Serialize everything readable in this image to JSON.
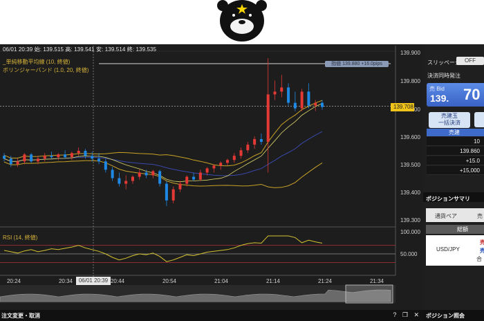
{
  "chart": {
    "info_line": "06/01 20:39 始: 139.515 高: 139.541 安: 139.514 終: 139.535",
    "legend_sma": "_単純移動平均線 (10, 終値)",
    "legend_bb": "ボリンジャーバンド (1.0, 20, 終値)",
    "legend_rsi": "RSI (14, 終値)",
    "price_axis": [
      "139.900",
      "139.800",
      "139.700",
      "139.600",
      "139.500",
      "139.400",
      "139.300"
    ],
    "rsi_axis": [
      "100.000",
      "50.000"
    ],
    "time_axis": [
      "20:24",
      "20:34",
      "20:44",
      "20:54",
      "21:04",
      "21:14",
      "21:24",
      "21:34"
    ],
    "cursor_time": "06/01 20:39",
    "current_price_tag": "139.708",
    "hline_tag": "指値 139.880 +16.0pips",
    "colors": {
      "up": "#e53935",
      "down": "#1e88e5",
      "band": "#c9a227",
      "sma": "#3949ab",
      "rsi": "#d6c22f"
    },
    "candles": [
      {
        "o": 139.53,
        "h": 139.54,
        "l": 139.51,
        "c": 139.52
      },
      {
        "o": 139.52,
        "h": 139.53,
        "l": 139.49,
        "c": 139.5
      },
      {
        "o": 139.5,
        "h": 139.52,
        "l": 139.49,
        "c": 139.51
      },
      {
        "o": 139.51,
        "h": 139.54,
        "l": 139.5,
        "c": 139.535
      },
      {
        "o": 139.535,
        "h": 139.54,
        "l": 139.505,
        "c": 139.51
      },
      {
        "o": 139.51,
        "h": 139.53,
        "l": 139.5,
        "c": 139.52
      },
      {
        "o": 139.52,
        "h": 139.54,
        "l": 139.51,
        "c": 139.53
      },
      {
        "o": 139.53,
        "h": 139.545,
        "l": 139.52,
        "c": 139.525
      },
      {
        "o": 139.525,
        "h": 139.54,
        "l": 139.515,
        "c": 139.535
      },
      {
        "o": 139.535,
        "h": 139.55,
        "l": 139.52,
        "c": 139.525
      },
      {
        "o": 139.525,
        "h": 139.545,
        "l": 139.515,
        "c": 139.54
      },
      {
        "o": 139.54,
        "h": 139.56,
        "l": 139.53,
        "c": 139.548
      },
      {
        "o": 139.548,
        "h": 139.555,
        "l": 139.52,
        "c": 139.53
      },
      {
        "o": 139.53,
        "h": 139.545,
        "l": 139.51,
        "c": 139.52
      },
      {
        "o": 139.52,
        "h": 139.54,
        "l": 139.5,
        "c": 139.51
      },
      {
        "o": 139.51,
        "h": 139.52,
        "l": 139.47,
        "c": 139.48
      },
      {
        "o": 139.48,
        "h": 139.49,
        "l": 139.44,
        "c": 139.45
      },
      {
        "o": 139.45,
        "h": 139.47,
        "l": 139.42,
        "c": 139.43
      },
      {
        "o": 139.43,
        "h": 139.46,
        "l": 139.41,
        "c": 139.44
      },
      {
        "o": 139.44,
        "h": 139.46,
        "l": 139.43,
        "c": 139.455
      },
      {
        "o": 139.455,
        "h": 139.48,
        "l": 139.445,
        "c": 139.47
      },
      {
        "o": 139.47,
        "h": 139.48,
        "l": 139.45,
        "c": 139.46
      },
      {
        "o": 139.46,
        "h": 139.48,
        "l": 139.45,
        "c": 139.475
      },
      {
        "o": 139.475,
        "h": 139.48,
        "l": 139.42,
        "c": 139.43
      },
      {
        "o": 139.43,
        "h": 139.44,
        "l": 139.35,
        "c": 139.37
      },
      {
        "o": 139.37,
        "h": 139.42,
        "l": 139.36,
        "c": 139.41
      },
      {
        "o": 139.41,
        "h": 139.44,
        "l": 139.4,
        "c": 139.43
      },
      {
        "o": 139.43,
        "h": 139.46,
        "l": 139.42,
        "c": 139.455
      },
      {
        "o": 139.455,
        "h": 139.47,
        "l": 139.44,
        "c": 139.445
      },
      {
        "o": 139.445,
        "h": 139.48,
        "l": 139.44,
        "c": 139.47
      },
      {
        "o": 139.47,
        "h": 139.49,
        "l": 139.46,
        "c": 139.485
      },
      {
        "o": 139.485,
        "h": 139.5,
        "l": 139.47,
        "c": 139.495
      },
      {
        "o": 139.495,
        "h": 139.51,
        "l": 139.48,
        "c": 139.505
      },
      {
        "o": 139.505,
        "h": 139.52,
        "l": 139.495,
        "c": 139.515
      },
      {
        "o": 139.515,
        "h": 139.54,
        "l": 139.505,
        "c": 139.53
      },
      {
        "o": 139.53,
        "h": 139.56,
        "l": 139.52,
        "c": 139.55
      },
      {
        "o": 139.55,
        "h": 139.58,
        "l": 139.54,
        "c": 139.57
      },
      {
        "o": 139.57,
        "h": 139.6,
        "l": 139.555,
        "c": 139.59
      },
      {
        "o": 139.59,
        "h": 139.61,
        "l": 139.57,
        "c": 139.58
      },
      {
        "o": 139.58,
        "h": 139.88,
        "l": 139.47,
        "c": 139.75
      },
      {
        "o": 139.75,
        "h": 139.8,
        "l": 139.73,
        "c": 139.76
      },
      {
        "o": 139.76,
        "h": 139.82,
        "l": 139.74,
        "c": 139.775
      },
      {
        "o": 139.775,
        "h": 139.79,
        "l": 139.71,
        "c": 139.72
      },
      {
        "o": 139.72,
        "h": 139.76,
        "l": 139.69,
        "c": 139.7
      },
      {
        "o": 139.7,
        "h": 139.77,
        "l": 139.69,
        "c": 139.76
      },
      {
        "o": 139.76,
        "h": 139.79,
        "l": 139.7,
        "c": 139.71
      },
      {
        "o": 139.71,
        "h": 139.73,
        "l": 139.69,
        "c": 139.72
      },
      {
        "o": 139.72,
        "h": 139.73,
        "l": 139.695,
        "c": 139.705
      }
    ],
    "rsi_values": [
      58,
      55,
      52,
      57,
      60,
      55,
      58,
      62,
      60,
      63,
      66,
      70,
      64,
      60,
      56,
      50,
      42,
      36,
      40,
      46,
      50,
      48,
      52,
      44,
      32,
      36,
      42,
      48,
      46,
      50,
      54,
      56,
      58,
      60,
      64,
      70,
      74,
      76,
      75,
      92,
      92,
      92,
      92,
      88,
      76,
      82,
      78,
      75
    ]
  },
  "bottom_bar": {
    "title": "注文変更・取消",
    "icons": [
      "help-icon",
      "restore-icon",
      "close-icon"
    ],
    "help_glyph": "?",
    "restore_glyph": "❐",
    "close_glyph": "✕"
  },
  "right_panel": {
    "slippage_label": "スリッページ",
    "slippage_value": "OFF",
    "settle_label": "決済同時発注",
    "bid_label": "売 Bid",
    "bid_price_small": "139.",
    "bid_price_big": "70",
    "close_button_line1": "売建玉",
    "close_button_line2": "一括決済",
    "sell_header": "売建",
    "values": [
      "10",
      "139.860",
      "+15.0",
      "+15,000"
    ],
    "summary_title": "ポジションサマリ",
    "tab_pair": "通貨ペア",
    "tab_side": "売",
    "summary_header": "総額",
    "pair": "USD/JPY",
    "side_sell": "売",
    "side_buy": "売",
    "side_total": "合"
  },
  "position_inquiry_title": "ポジション照会"
}
